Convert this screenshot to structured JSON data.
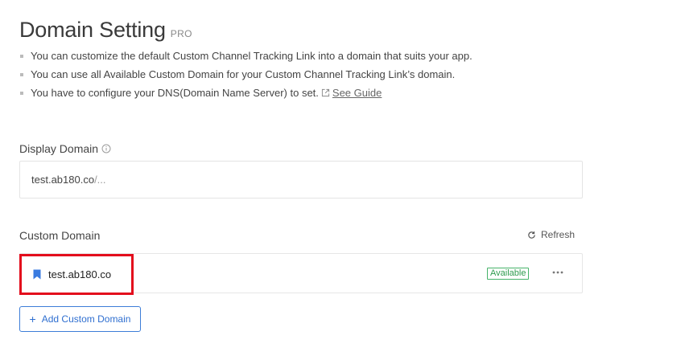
{
  "header": {
    "title": "Domain Setting",
    "badge": "PRO"
  },
  "bullets": [
    "You can customize the default Custom Channel Tracking Link into a domain that suits your app.",
    "You can use all Available Custom Domain for your Custom Channel Tracking Link’s domain.",
    "You have to configure your DNS(Domain Name Server) to set."
  ],
  "guide_link": "See Guide",
  "display_domain": {
    "label": "Display Domain",
    "value": "test.ab180.co",
    "suffix": "/..."
  },
  "custom_domain": {
    "label": "Custom Domain",
    "refresh_label": "Refresh",
    "items": [
      {
        "name": "test.ab180.co",
        "status": "Available"
      }
    ],
    "add_label": "Add Custom Domain"
  },
  "colors": {
    "accent": "#2f6fd0",
    "available": "#2e9b4e",
    "highlight": "#e30c1c"
  }
}
